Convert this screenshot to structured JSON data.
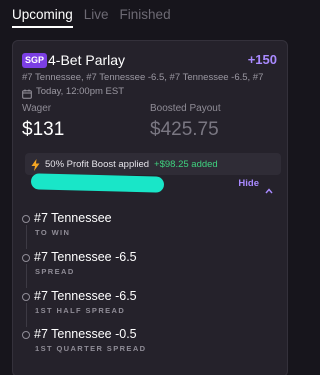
{
  "tabs": [
    {
      "label": "Upcoming",
      "active": true
    },
    {
      "label": "Live",
      "active": false
    },
    {
      "label": "Finished",
      "active": false
    }
  ],
  "bet": {
    "badge": "SGP",
    "title": "4-Bet Parlay",
    "odds": "+150",
    "legs_summary": "#7 Tennessee, #7 Tennessee -6.5, #7 Tennessee -6.5, #7",
    "date": "Today, 12:00pm EST",
    "wager_label": "Wager",
    "wager_value": "$131",
    "payout_label": "Boosted Payout",
    "payout_value": "$425.75",
    "boost_text": "50% Profit Boost applied",
    "boost_amount": "+$98.25 added",
    "hide_label": "Hide"
  },
  "legs": [
    {
      "name": "#7 Tennessee",
      "type": "TO WIN"
    },
    {
      "name": "#7 Tennessee -6.5",
      "type": "SPREAD"
    },
    {
      "name": "#7 Tennessee -6.5",
      "type": "1ST HALF SPREAD"
    },
    {
      "name": "#7 Tennessee -0.5",
      "type": "1ST QUARTER SPREAD"
    }
  ],
  "colors": {
    "background": "#17151c",
    "card": "#25222b",
    "accent": "#a98aff",
    "sgp_badge": "#7b3fe4",
    "boost_green": "#3fd27f",
    "redaction": "#19e6c8"
  },
  "icons": {
    "date": "calendar-icon",
    "boost": "lightning-bolt-icon",
    "hide": "chevron-up-icon",
    "leg": "circle-icon"
  }
}
